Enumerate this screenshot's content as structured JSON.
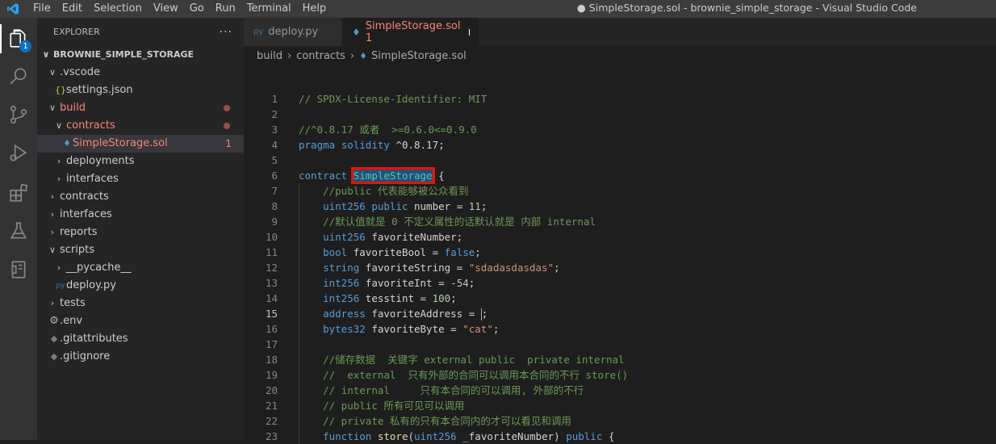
{
  "window": {
    "title": "● SimpleStorage.sol - brownie_simple_storage - Visual Studio Code",
    "menu": [
      "File",
      "Edit",
      "Selection",
      "View",
      "Go",
      "Run",
      "Terminal",
      "Help"
    ]
  },
  "activity_bar": {
    "explorer_badge": "1",
    "icons": [
      "explorer-icon",
      "search-icon",
      "source-control-icon",
      "run-debug-icon",
      "extensions-icon",
      "testing-icon",
      "remote-explorer-icon"
    ]
  },
  "explorer": {
    "title": "EXPLORER",
    "more": "···",
    "root": "BROWNIE_SIMPLE_STORAGE",
    "items": [
      {
        "label": ".vscode",
        "chevron": "∨",
        "icon": "",
        "red": false,
        "dot": false,
        "count": ""
      },
      {
        "label": "settings.json",
        "chevron": "",
        "icon": "{}",
        "red": false,
        "dot": false,
        "count": ""
      },
      {
        "label": "build",
        "chevron": "∨",
        "icon": "",
        "red": true,
        "dot": true,
        "count": ""
      },
      {
        "label": "contracts",
        "chevron": "∨",
        "icon": "",
        "red": true,
        "dot": true,
        "count": ""
      },
      {
        "label": "SimpleStorage.sol",
        "chevron": "",
        "icon": "♦",
        "red": true,
        "dot": false,
        "count": "1"
      },
      {
        "label": "deployments",
        "chevron": "›",
        "icon": "",
        "red": false,
        "dot": false,
        "count": ""
      },
      {
        "label": "interfaces",
        "chevron": "›",
        "icon": "",
        "red": false,
        "dot": false,
        "count": ""
      },
      {
        "label": "contracts",
        "chevron": "›",
        "icon": "",
        "red": false,
        "dot": false,
        "count": ""
      },
      {
        "label": "interfaces",
        "chevron": "›",
        "icon": "",
        "red": false,
        "dot": false,
        "count": ""
      },
      {
        "label": "reports",
        "chevron": "›",
        "icon": "",
        "red": false,
        "dot": false,
        "count": ""
      },
      {
        "label": "scripts",
        "chevron": "∨",
        "icon": "",
        "red": false,
        "dot": false,
        "count": ""
      },
      {
        "label": "__pycache__",
        "chevron": "›",
        "icon": "",
        "red": false,
        "dot": false,
        "count": ""
      },
      {
        "label": "deploy.py",
        "chevron": "",
        "icon": "py",
        "red": false,
        "dot": false,
        "count": ""
      },
      {
        "label": "tests",
        "chevron": "›",
        "icon": "",
        "red": false,
        "dot": false,
        "count": ""
      },
      {
        "label": ".env",
        "chevron": "",
        "icon": "⚙",
        "red": false,
        "dot": false,
        "count": ""
      },
      {
        "label": ".gitattributes",
        "chevron": "",
        "icon": "◆",
        "red": false,
        "dot": false,
        "count": ""
      },
      {
        "label": ".gitignore",
        "chevron": "",
        "icon": "◆",
        "red": false,
        "dot": false,
        "count": ""
      }
    ]
  },
  "tabs": [
    {
      "label": "deploy.py",
      "icon": "py",
      "active": false,
      "dirty": false,
      "problems": ""
    },
    {
      "label": "SimpleStorage.sol",
      "icon": "♦",
      "active": true,
      "dirty": true,
      "problems": "1"
    }
  ],
  "breadcrumb": [
    "build",
    "contracts",
    "SimpleStorage.sol"
  ],
  "editor": {
    "current_line": 15,
    "lines": [
      {
        "n": "1",
        "t": [
          [
            "cm",
            "// SPDX-License-Identifier: MIT"
          ]
        ]
      },
      {
        "n": "2",
        "t": []
      },
      {
        "n": "3",
        "t": [
          [
            "cm",
            "//^0.8.17 或者  >=0.6.0<=0.9.0"
          ]
        ]
      },
      {
        "n": "4",
        "t": [
          [
            "kw",
            "pragma"
          ],
          [
            "id",
            " "
          ],
          [
            "kw",
            "solidity"
          ],
          [
            "id",
            " ^0.8.17;"
          ]
        ]
      },
      {
        "n": "5",
        "t": []
      },
      {
        "n": "6",
        "t": [
          [
            "kw",
            "contract"
          ],
          [
            "id",
            " "
          ],
          [
            "hl",
            "SimpleStorage"
          ],
          [
            "id",
            " {"
          ]
        ]
      },
      {
        "n": "7",
        "t": [
          [
            "id",
            "    "
          ],
          [
            "cm",
            "//public 代表能够被公众看到"
          ]
        ]
      },
      {
        "n": "8",
        "t": [
          [
            "id",
            "    "
          ],
          [
            "kw",
            "uint256"
          ],
          [
            "id",
            " "
          ],
          [
            "kw",
            "public"
          ],
          [
            "id",
            " number = "
          ],
          [
            "nm",
            "11"
          ],
          [
            "id",
            ";"
          ]
        ]
      },
      {
        "n": "9",
        "t": [
          [
            "id",
            "    "
          ],
          [
            "cm",
            "//默认值就是 0 不定义属性的话默认就是 内部 internal"
          ]
        ]
      },
      {
        "n": "10",
        "t": [
          [
            "id",
            "    "
          ],
          [
            "kw",
            "uint256"
          ],
          [
            "id",
            " favoriteNumber;"
          ]
        ]
      },
      {
        "n": "11",
        "t": [
          [
            "id",
            "    "
          ],
          [
            "kw",
            "bool"
          ],
          [
            "id",
            " favoriteBool = "
          ],
          [
            "kw",
            "false"
          ],
          [
            "id",
            ";"
          ]
        ]
      },
      {
        "n": "12",
        "t": [
          [
            "id",
            "    "
          ],
          [
            "kw",
            "string"
          ],
          [
            "id",
            " favoriteString = "
          ],
          [
            "st",
            "\"sdadasdasdas\""
          ],
          [
            "id",
            ";"
          ]
        ]
      },
      {
        "n": "13",
        "t": [
          [
            "id",
            "    "
          ],
          [
            "kw",
            "int256"
          ],
          [
            "id",
            " favoriteInt = -"
          ],
          [
            "nm",
            "54"
          ],
          [
            "id",
            ";"
          ]
        ]
      },
      {
        "n": "14",
        "t": [
          [
            "id",
            "    "
          ],
          [
            "kw",
            "int256"
          ],
          [
            "id",
            " tesstint = "
          ],
          [
            "nm",
            "100"
          ],
          [
            "id",
            ";"
          ]
        ]
      },
      {
        "n": "15",
        "t": [
          [
            "id",
            "    "
          ],
          [
            "kw",
            "address"
          ],
          [
            "id",
            " favoriteAddress = "
          ],
          [
            "cursor",
            ""
          ],
          [
            "id",
            ";"
          ]
        ]
      },
      {
        "n": "16",
        "t": [
          [
            "id",
            "    "
          ],
          [
            "kw",
            "bytes32"
          ],
          [
            "id",
            " favoriteByte = "
          ],
          [
            "st",
            "\"cat\""
          ],
          [
            "id",
            ";"
          ]
        ]
      },
      {
        "n": "17",
        "t": []
      },
      {
        "n": "18",
        "t": [
          [
            "id",
            "    "
          ],
          [
            "cm",
            "//储存数据  关键字 external public  private internal"
          ]
        ]
      },
      {
        "n": "19",
        "t": [
          [
            "id",
            "    "
          ],
          [
            "cm",
            "//  external  只有外部的合同可以调用本合同的不行 store()"
          ]
        ]
      },
      {
        "n": "20",
        "t": [
          [
            "id",
            "    "
          ],
          [
            "cm",
            "// internal     只有本合同的可以调用, 外部的不行"
          ]
        ]
      },
      {
        "n": "21",
        "t": [
          [
            "id",
            "    "
          ],
          [
            "cm",
            "// public 所有可见可以调用"
          ]
        ]
      },
      {
        "n": "22",
        "t": [
          [
            "id",
            "    "
          ],
          [
            "cm",
            "// private 私有的只有本合同内的才可以看见和调用"
          ]
        ]
      },
      {
        "n": "23",
        "t": [
          [
            "id",
            "    "
          ],
          [
            "kw",
            "function"
          ],
          [
            "id",
            " "
          ],
          [
            "fn",
            "store"
          ],
          [
            "id",
            "("
          ],
          [
            "kw",
            "uint256"
          ],
          [
            "id",
            " _favoriteNumber) "
          ],
          [
            "kw",
            "public"
          ],
          [
            "id",
            " {"
          ]
        ]
      }
    ]
  }
}
